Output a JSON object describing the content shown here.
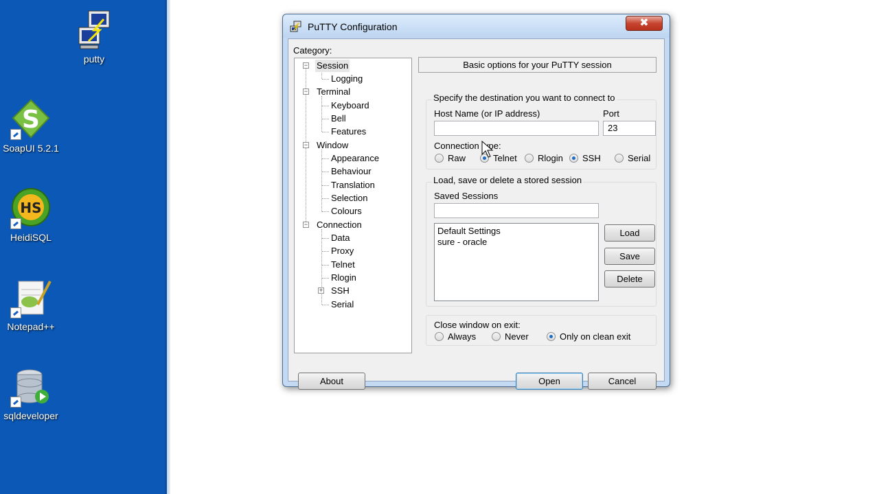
{
  "desktop": {
    "icons": [
      {
        "label": "putty",
        "icon": "putty-icon"
      },
      {
        "label": "SoapUI 5.2.1",
        "icon": "soapui-icon"
      },
      {
        "label": "HeidiSQL",
        "icon": "heidisql-icon",
        "badge": "HS"
      },
      {
        "label": "Notepad++",
        "icon": "notepad-plus-plus-icon"
      },
      {
        "label": "sqldeveloper",
        "icon": "sqldeveloper-icon"
      }
    ],
    "colors": {
      "background": "#0b58b6"
    }
  },
  "window": {
    "title": "PuTTY Configuration",
    "close_glyph": "✖"
  },
  "category": {
    "label": "Category:",
    "tree": [
      {
        "label": "Session",
        "selected": true
      },
      {
        "label": "Logging"
      },
      {
        "label": "Terminal"
      },
      {
        "label": "Keyboard"
      },
      {
        "label": "Bell"
      },
      {
        "label": "Features"
      },
      {
        "label": "Window"
      },
      {
        "label": "Appearance"
      },
      {
        "label": "Behaviour"
      },
      {
        "label": "Translation"
      },
      {
        "label": "Selection"
      },
      {
        "label": "Colours"
      },
      {
        "label": "Connection"
      },
      {
        "label": "Data"
      },
      {
        "label": "Proxy"
      },
      {
        "label": "Telnet"
      },
      {
        "label": "Rlogin"
      },
      {
        "label": "SSH",
        "collapsed": true
      },
      {
        "label": "Serial"
      }
    ]
  },
  "session": {
    "header": "Basic options for your PuTTY session",
    "destination": {
      "title": "Specify the destination you want to connect to",
      "host_label": "Host Name (or IP address)",
      "host_value": "",
      "port_label": "Port",
      "port_value": "23",
      "conn_type_label": "Connection type:",
      "conn_types": [
        {
          "label": "Raw",
          "checked": false
        },
        {
          "label": "Telnet",
          "checked": true
        },
        {
          "label": "Rlogin",
          "checked": false
        },
        {
          "label": "SSH",
          "checked": true
        },
        {
          "label": "Serial",
          "checked": false
        }
      ]
    },
    "stored": {
      "title": "Load, save or delete a stored session",
      "saved_label": "Saved Sessions",
      "saved_value": "",
      "sessions": [
        "Default Settings",
        "sure - oracle"
      ],
      "load_label": "Load",
      "save_label": "Save",
      "delete_label": "Delete"
    },
    "close_on_exit": {
      "label": "Close window on exit:",
      "options": [
        {
          "label": "Always",
          "checked": false
        },
        {
          "label": "Never",
          "checked": false
        },
        {
          "label": "Only on clean exit",
          "checked": true
        }
      ]
    }
  },
  "footer": {
    "about_label": "About",
    "open_label": "Open",
    "cancel_label": "Cancel"
  }
}
